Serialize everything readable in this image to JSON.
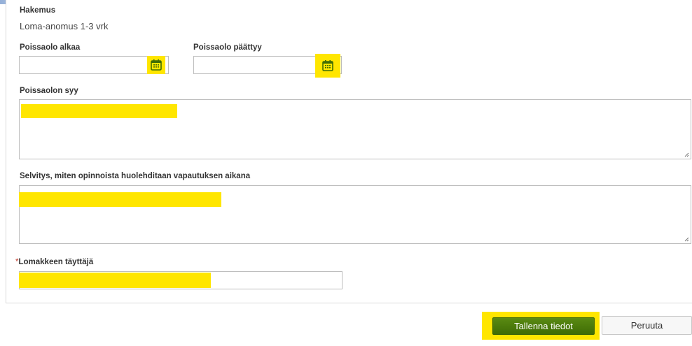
{
  "colors": {
    "highlight": "#ffe600",
    "save_button": "#4a7c0b",
    "required_marker": "#c0392b",
    "calendar_icon": "#3f6d05"
  },
  "form": {
    "application_label": "Hakemus",
    "application_value": "Loma-anomus 1-3 vrk",
    "absence_start": {
      "label": "Poissaolo alkaa",
      "value": "",
      "icon": "calendar-icon"
    },
    "absence_end": {
      "label": "Poissaolo päättyy",
      "value": "",
      "icon": "calendar-icon"
    },
    "absence_reason": {
      "label": "Poissaolon syy",
      "value": ""
    },
    "study_plan": {
      "label": "Selvitys, miten opinnoista huolehditaan vapautuksen aikana",
      "value": ""
    },
    "filler": {
      "required_marker": "*",
      "label": "Lomakkeen täyttäjä",
      "value": ""
    }
  },
  "actions": {
    "save_label": "Tallenna tiedot",
    "cancel_label": "Peruuta"
  }
}
